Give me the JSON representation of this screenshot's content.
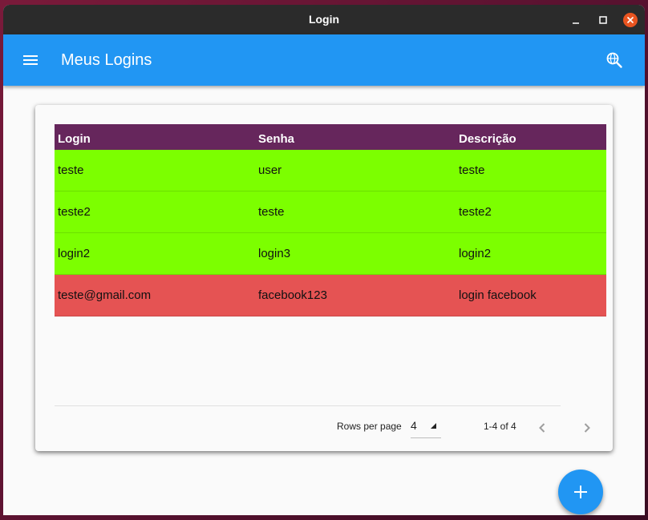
{
  "window": {
    "title": "Login"
  },
  "appbar": {
    "title": "Meus Logins"
  },
  "icons": {
    "menu": "hamburger-menu-icon",
    "globe": "globe-search-icon",
    "add": "plus-icon",
    "prev": "chevron-left-icon",
    "next": "chevron-right-icon"
  },
  "table": {
    "columns": [
      "Login",
      "Senha",
      "Descrição"
    ],
    "rows": [
      {
        "login": "teste",
        "senha": "user",
        "descricao": "teste",
        "color": "#7cff00"
      },
      {
        "login": "teste2",
        "senha": "teste",
        "descricao": "teste2",
        "color": "#7cff00"
      },
      {
        "login": "login2",
        "senha": "login3",
        "descricao": "login2",
        "color": "#7cff00"
      },
      {
        "login": "teste@gmail.com",
        "senha": "facebook123",
        "descricao": "login facebook",
        "color": "#e55353"
      }
    ]
  },
  "pagination": {
    "rows_per_page_label": "Rows per page",
    "rows_per_page_value": "4",
    "range_label": "1-4 of 4"
  },
  "colors": {
    "appbar": "#2196f3",
    "header": "#66265c",
    "titlebar": "#2b2b2b",
    "close": "#e95420"
  }
}
